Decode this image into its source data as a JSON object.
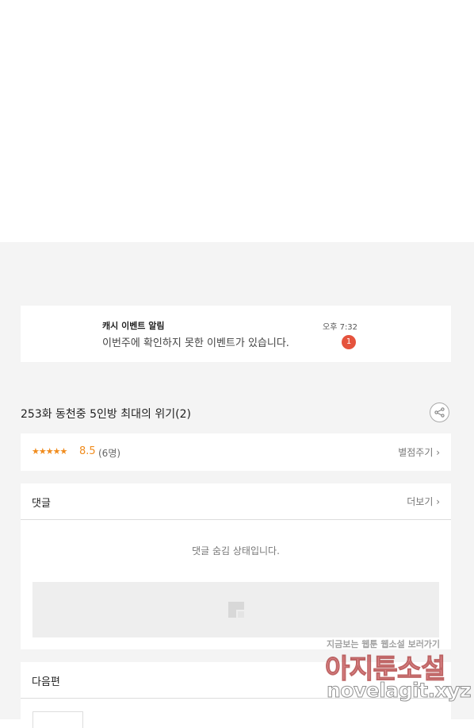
{
  "notification": {
    "title": "캐시 이벤트 알림",
    "body": "이번주에 확인하지 못한 이벤트가 있습니다.",
    "time": "오후 7:32",
    "badge": "1"
  },
  "episode": {
    "title": "253화 동천중 5인방 최대의 위기(2)"
  },
  "rating": {
    "stars": "★★★★★",
    "score": "8.5",
    "count": "(6명)",
    "rate_link": "별점주기 ›"
  },
  "comments": {
    "title": "댓글",
    "more": "더보기 ›",
    "hidden_message": "댓글 숨김 상태입니다."
  },
  "next_episode": {
    "title": "다음편"
  },
  "watermark": {
    "top": "지금보는 웹툰 웹소설 보러가기",
    "main": "아지툰소설",
    "url": "novelagit.xyz"
  },
  "colors": {
    "accent": "#f08c1e",
    "badge": "#e5533d",
    "background": "#f4f4f4"
  }
}
